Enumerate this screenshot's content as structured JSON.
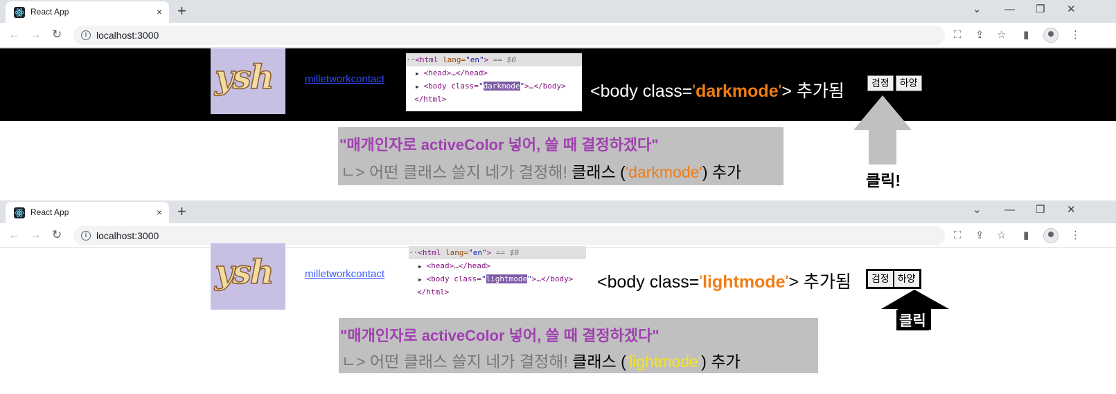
{
  "colors": {
    "tabstrip": "#dee1e6",
    "header_dark": "#000000",
    "note_bg": "#c0c0c0",
    "note_title": "#a040b0",
    "class_orange": "#f07d14",
    "class_yellow": "#f5e61a",
    "arrow_gray": "#c0c0c0"
  },
  "screens": [
    {
      "tab": {
        "title": "React App",
        "favicon": "react-icon",
        "close": "×"
      },
      "new_tab": "+",
      "window_controls": {
        "menu": "⌄",
        "minimize": "—",
        "restore": "❐",
        "close": "✕"
      },
      "url": "localhost:3000",
      "toolbar_icons": [
        "translate-icon",
        "share-icon",
        "star-icon",
        "sidebar-icon",
        "profile-icon",
        "menu-icon"
      ],
      "logo_text": "ysh",
      "contact_link": "milletworkcontact",
      "devtools": {
        "dots": "··",
        "html_open_tag": "<html",
        "html_lang_attr": " lang=",
        "html_lang_val": "\"en\"",
        "html_close_bracket": ">",
        "selected_marker": " == $0",
        "head_line": "<head>…</head>",
        "body_prefix": "<body class=",
        "body_quote_open": "\"",
        "body_class": "darkmode",
        "body_quote_close": "\"",
        "body_suffix": ">…</body>",
        "html_close": "</html>"
      },
      "caption": {
        "prefix": "<body class=",
        "q1": "'",
        "class_name": "darkmode",
        "q2": "'",
        "suffix": "> 추가됨"
      },
      "buttons": [
        {
          "label": "검정"
        },
        {
          "label": "하양"
        }
      ],
      "note": {
        "line1": "\"매개인자로 activeColor 넣어, 쓸 때 결정하겠다\"",
        "line2_gray": "ㄴ> 어떤 클래스 쓸지 네가 결정해! ",
        "line2_black": "클래스 (",
        "line2_class": "'darkmode'",
        "line2_end": ") 추가"
      },
      "click_label": "클릭!"
    },
    {
      "tab": {
        "title": "React App",
        "favicon": "react-icon",
        "close": "×"
      },
      "new_tab": "+",
      "window_controls": {
        "menu": "⌄",
        "minimize": "—",
        "restore": "❐",
        "close": "✕"
      },
      "url": "localhost:3000",
      "toolbar_icons": [
        "translate-icon",
        "share-icon",
        "star-icon",
        "sidebar-icon",
        "profile-icon",
        "menu-icon"
      ],
      "logo_text": "ysh",
      "contact_link": "milletworkcontact",
      "devtools": {
        "dots": "··",
        "html_open_tag": "<html",
        "html_lang_attr": " lang=",
        "html_lang_val": "\"en\"",
        "html_close_bracket": ">",
        "selected_marker": " == $0",
        "head_line": "<head>…</head>",
        "body_prefix": "<body class=",
        "body_quote_open": "\"",
        "body_class": "lightmode",
        "body_quote_close": "\"",
        "body_suffix": ">…</body>",
        "html_close": "</html>"
      },
      "caption": {
        "prefix": "<body class=",
        "q1": "'",
        "class_name": "lightmode",
        "q2": "'",
        "suffix": "> 추가됨"
      },
      "buttons": [
        {
          "label": "검정"
        },
        {
          "label": "하양"
        }
      ],
      "note": {
        "line1": "\"매개인자로 activeColor 넣어, 쓸 때 결정하겠다\"",
        "line2_gray": "ㄴ> 어떤 클래스 쓸지 네가 결정해! ",
        "line2_black": "클래스 (",
        "line2_class": "'lightmode'",
        "line2_end": ") 추가"
      },
      "click_label": "클릭"
    }
  ]
}
